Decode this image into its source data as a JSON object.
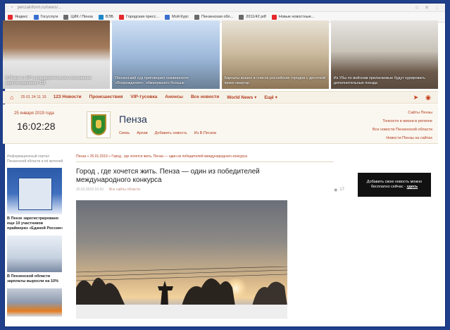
{
  "browser": {
    "url": "penzainform.ru/news/...",
    "bookmarks": [
      {
        "label": "Яндекс",
        "color": "#e8272b"
      },
      {
        "label": "Госуслуги",
        "color": "#3a6fd0"
      },
      {
        "label": "ЦИК / Пенза",
        "color": "#6a6a6a"
      },
      {
        "label": "ВЭБ",
        "color": "#1e88c8"
      },
      {
        "label": "Городская пресс...",
        "color": "#e8272b"
      },
      {
        "label": "Мой Курс",
        "color": "#3a6fd0"
      },
      {
        "label": "Пензенская обл...",
        "color": "#6a6a6a"
      },
      {
        "label": "2011/42 pdf",
        "color": "#6a6a6a"
      },
      {
        "label": "Новые новостные...",
        "color": "#e8272b"
      }
    ]
  },
  "news_strip": [
    {
      "caption": "В Пензе от ЕР в предварительном голосовании зарегистрировано 119"
    },
    {
      "caption": "Пензенский суд приговорил осваивателя «Возрождения», обманувшего больше"
    },
    {
      "caption": "Бархаты вошел в список российских городов с десяткой ярких квартир"
    },
    {
      "caption": "Из Убы по войскам прилагаемые будут курировать дополнительные поезда"
    }
  ],
  "nav": {
    "home_icon": "house-icon",
    "letters": "25 01 24 11 15",
    "items": [
      "123 Новости",
      "Происшествия",
      "VIP-тусовка",
      "Анонсы",
      "Все новости",
      "World News ▾",
      "Ещё ▾"
    ],
    "icons": [
      "telegram-icon",
      "rss-icon"
    ]
  },
  "header": {
    "date": "25 января 2019 года",
    "time": "16:02:28",
    "city": "Пенза",
    "sublinks": [
      "Связь",
      "Архив",
      "Добавить новость",
      "Из В.Песков"
    ],
    "right_links": [
      "Сайты Пензы",
      "Тонкости и жизни в регионе",
      "Все новости Пензенской области",
      "Новости Пензы на сайтах"
    ]
  },
  "left_column": {
    "intro": "Информационный портал Пензенской области и её жителей",
    "items": [
      {
        "caption": "В Пензе зарегистрировано еще 10 участников праймериз «Единой России»"
      },
      {
        "caption": "В Пензенской области зарплаты выросли на 10%"
      },
      {
        "caption": ""
      }
    ]
  },
  "article": {
    "breadcrumbs": "Пенза » 25.01.2019 » Город , где хочется жить. Пенза — один из победителей международного конкурса",
    "title": "Город , где хочется жить. Пенза — один из победителей международного конкурса",
    "date": "25.01.2019 16:10",
    "source": "Все сайты области",
    "views": "17"
  },
  "promo": {
    "text": "Добавить свою новость можно бесплатно сейчас -",
    "link": "здесь"
  }
}
